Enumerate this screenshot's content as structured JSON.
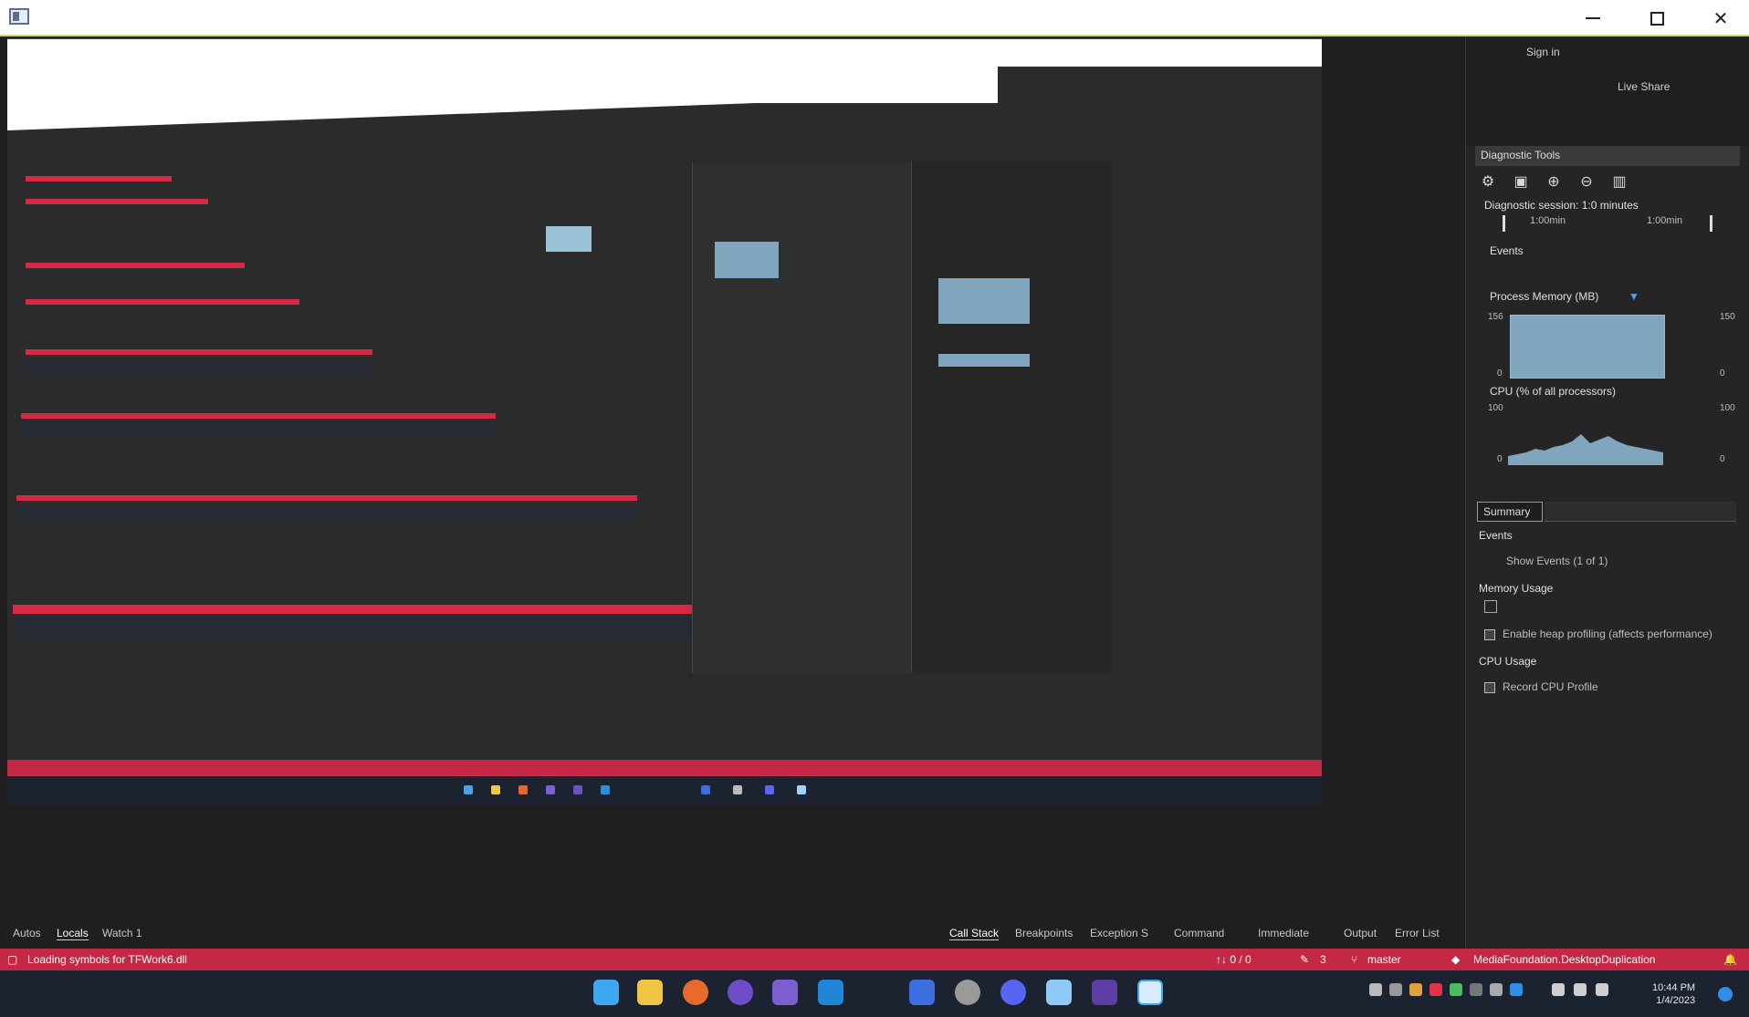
{
  "window": {
    "min_label": "",
    "max_label": "",
    "close_label": "✕"
  },
  "right_pane": {
    "sign_in": "Sign in",
    "live_share": "Live Share",
    "header": "Diagnostic Tools",
    "session": "Diagnostic session: 1:0 minutes",
    "time_left": "1:00min",
    "time_right": "1:00min",
    "events_title": "Events",
    "process_memory": "Process Memory (MB)",
    "mem_max_left": "156",
    "mem_max_right": "150",
    "mem_min_left": "0",
    "mem_min_right": "0",
    "cpu_title": "CPU (% of all processors)",
    "cpu_max_left": "100",
    "cpu_max_right": "100",
    "cpu_min_left": "0",
    "cpu_min_right": "0",
    "summary_tab": "Summary",
    "events_section": "Events",
    "show_events": "Show Events (1 of 1)",
    "memory_usage": "Memory Usage",
    "heap_profiling": "Enable heap profiling (affects performance)",
    "cpu_usage": "CPU Usage",
    "record_cpu": "Record CPU Profile"
  },
  "bottom_tabs": {
    "left": [
      "Autos",
      "Locals",
      "Watch 1"
    ],
    "right": [
      "Call Stack",
      "Breakpoints",
      "Exception S",
      "Command",
      "Immediate",
      "Output",
      "Error List"
    ]
  },
  "status": {
    "loading": "Loading symbols for TFWork6.dll",
    "errors": "↑↓ 0 / 0",
    "pencil": "3",
    "branch": "master",
    "project": "MediaFoundation.DesktopDuplication"
  },
  "clock": {
    "time": "10:44 PM",
    "date": "1/4/2023"
  }
}
